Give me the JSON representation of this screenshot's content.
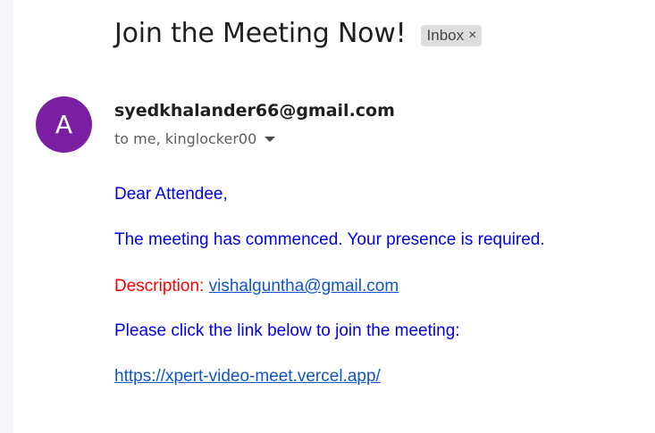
{
  "email": {
    "subject": "Join the Meeting Now!",
    "label_chip": "Inbox",
    "label_remove_glyph": "×",
    "avatar_letter": "A",
    "sender": "syedkhalander66@gmail.com",
    "recipients": "to me, kinglocker00"
  },
  "body": {
    "greeting": "Dear Attendee,",
    "line1": "The meeting has commenced. Your presence is required.",
    "description_label": "Description:",
    "description_link": "vishalguntha@gmail.com",
    "instruction": "Please click the link below to join the meeting:",
    "meeting_link": "https://xpert-video-meet.vercel.app/"
  },
  "colors": {
    "avatar_bg": "#7b1fa2",
    "body_text": "#0000ee",
    "description_label": "#ff0000",
    "link": "#1155cc",
    "chip_bg": "#dddddd"
  },
  "icons": {
    "chip_close": "close-icon",
    "recipients_toggle": "chevron-down-icon"
  }
}
